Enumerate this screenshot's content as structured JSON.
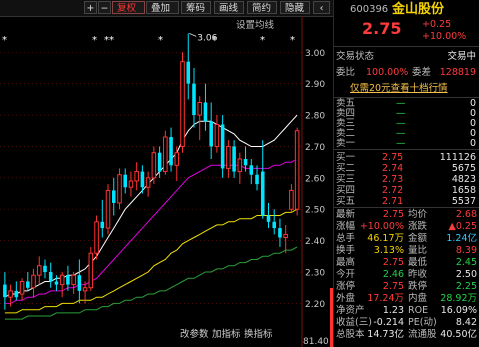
{
  "toolbar": {
    "items": [
      {
        "label": "+"
      },
      {
        "label": "−"
      },
      {
        "label": "复权"
      },
      {
        "label": "叠加"
      },
      {
        "label": "筹码"
      },
      {
        "label": "画线"
      },
      {
        "label": "简约"
      },
      {
        "label": "隐藏"
      },
      {
        "label": "‹"
      }
    ],
    "active_index": 2,
    "settings_label": "设置均线"
  },
  "markers": {
    "star": "*",
    "dstar": "**"
  },
  "bottom_buttons": [
    "改参数",
    "加指标",
    "换指标"
  ],
  "colors": {
    "up": "#ff3333",
    "down": "#00e5ff",
    "ma1": "#ffffff",
    "ma2": "#e000e0",
    "ma3": "#f0e000",
    "ma4": "#2a9f3a",
    "grid": "#7a1010"
  },
  "chart_data": {
    "type": "candlestick",
    "y_ticks": [
      "3.00",
      "2.90",
      "2.80",
      "2.70",
      "2.60",
      "2.50",
      "2.40",
      "2.30",
      "2.20"
    ],
    "ylim": [
      2.16,
      3.09
    ],
    "y_bottom_label": "81.40",
    "annotations": [
      {
        "text": "3.06",
        "value": 3.06
      }
    ],
    "ohlc": [
      [
        2.26,
        2.3,
        2.18,
        2.22
      ],
      [
        2.22,
        2.26,
        2.19,
        2.24
      ],
      [
        2.24,
        2.27,
        2.21,
        2.22
      ],
      [
        2.23,
        2.28,
        2.21,
        2.27
      ],
      [
        2.27,
        2.3,
        2.24,
        2.25
      ],
      [
        2.25,
        2.31,
        2.22,
        2.29
      ],
      [
        2.29,
        2.35,
        2.26,
        2.32
      ],
      [
        2.32,
        2.34,
        2.28,
        2.3
      ],
      [
        2.3,
        2.33,
        2.25,
        2.27
      ],
      [
        2.27,
        2.29,
        2.24,
        2.26
      ],
      [
        2.26,
        2.3,
        2.22,
        2.29
      ],
      [
        2.29,
        2.32,
        2.24,
        2.26
      ],
      [
        2.26,
        2.3,
        2.23,
        2.29
      ],
      [
        2.29,
        2.34,
        2.2,
        2.24
      ],
      [
        2.24,
        2.27,
        2.2,
        2.25
      ],
      [
        2.25,
        2.38,
        2.24,
        2.36
      ],
      [
        2.36,
        2.48,
        2.34,
        2.46
      ],
      [
        2.46,
        2.53,
        2.41,
        2.44
      ],
      [
        2.44,
        2.58,
        2.42,
        2.56
      ],
      [
        2.56,
        2.6,
        2.48,
        2.52
      ],
      [
        2.52,
        2.63,
        2.5,
        2.61
      ],
      [
        2.61,
        2.63,
        2.55,
        2.57
      ],
      [
        2.57,
        2.62,
        2.54,
        2.59
      ],
      [
        2.59,
        2.65,
        2.56,
        2.62
      ],
      [
        2.62,
        2.64,
        2.55,
        2.57
      ],
      [
        2.57,
        2.62,
        2.54,
        2.6
      ],
      [
        2.6,
        2.7,
        2.58,
        2.68
      ],
      [
        2.68,
        2.7,
        2.6,
        2.62
      ],
      [
        2.62,
        2.75,
        2.61,
        2.73
      ],
      [
        2.73,
        2.76,
        2.62,
        2.64
      ],
      [
        2.64,
        2.7,
        2.59,
        2.68
      ],
      [
        2.7,
        3.0,
        2.68,
        2.97
      ],
      [
        2.97,
        3.06,
        2.85,
        2.9
      ],
      [
        2.9,
        2.95,
        2.76,
        2.8
      ],
      [
        2.8,
        2.86,
        2.72,
        2.84
      ],
      [
        2.84,
        2.9,
        2.75,
        2.78
      ],
      [
        2.78,
        2.84,
        2.66,
        2.7
      ],
      [
        2.7,
        2.8,
        2.68,
        2.77
      ],
      [
        2.77,
        2.8,
        2.6,
        2.63
      ],
      [
        2.63,
        2.72,
        2.6,
        2.7
      ],
      [
        2.7,
        2.72,
        2.6,
        2.62
      ],
      [
        2.62,
        2.68,
        2.58,
        2.66
      ],
      [
        2.66,
        2.7,
        2.62,
        2.64
      ],
      [
        2.64,
        2.66,
        2.58,
        2.61
      ],
      [
        2.61,
        2.64,
        2.56,
        2.58
      ],
      [
        2.62,
        2.72,
        2.47,
        2.48
      ],
      [
        2.48,
        2.52,
        2.44,
        2.46
      ],
      [
        2.46,
        2.5,
        2.42,
        2.44
      ],
      [
        2.44,
        2.47,
        2.38,
        2.41
      ],
      [
        2.41,
        2.45,
        2.36,
        2.42
      ],
      [
        2.5,
        2.58,
        2.49,
        2.56
      ],
      [
        2.5,
        2.76,
        2.48,
        2.75
      ]
    ],
    "ma": [
      {
        "color": "#ffffff",
        "values": [
          2.22,
          2.23,
          2.23,
          2.24,
          2.24,
          2.25,
          2.26,
          2.27,
          2.27,
          2.28,
          2.28,
          2.29,
          2.29,
          2.3,
          2.31,
          2.33,
          2.35,
          2.38,
          2.41,
          2.44,
          2.47,
          2.5,
          2.52,
          2.54,
          2.56,
          2.58,
          2.6,
          2.62,
          2.64,
          2.66,
          2.68,
          2.72,
          2.75,
          2.77,
          2.78,
          2.78,
          2.78,
          2.77,
          2.76,
          2.75,
          2.74,
          2.72,
          2.71,
          2.7,
          2.7,
          2.7,
          2.71,
          2.72,
          2.74,
          2.76,
          2.78,
          2.8
        ]
      },
      {
        "color": "#e000e0",
        "values": [
          2.2,
          2.2,
          2.21,
          2.21,
          2.22,
          2.22,
          2.23,
          2.23,
          2.24,
          2.24,
          2.24,
          2.25,
          2.25,
          2.26,
          2.26,
          2.27,
          2.28,
          2.3,
          2.32,
          2.34,
          2.36,
          2.38,
          2.4,
          2.42,
          2.44,
          2.46,
          2.48,
          2.5,
          2.52,
          2.54,
          2.56,
          2.58,
          2.6,
          2.61,
          2.62,
          2.63,
          2.64,
          2.64,
          2.64,
          2.64,
          2.64,
          2.64,
          2.63,
          2.63,
          2.63,
          2.63,
          2.63,
          2.64,
          2.64,
          2.65,
          2.65,
          2.66
        ]
      },
      {
        "color": "#f0e000",
        "values": [
          2.17,
          2.17,
          2.17,
          2.18,
          2.18,
          2.18,
          2.18,
          2.19,
          2.19,
          2.19,
          2.2,
          2.2,
          2.2,
          2.21,
          2.21,
          2.21,
          2.22,
          2.22,
          2.23,
          2.24,
          2.25,
          2.26,
          2.27,
          2.28,
          2.29,
          2.3,
          2.32,
          2.33,
          2.34,
          2.36,
          2.37,
          2.39,
          2.4,
          2.41,
          2.42,
          2.43,
          2.44,
          2.45,
          2.45,
          2.46,
          2.46,
          2.47,
          2.47,
          2.47,
          2.48,
          2.48,
          2.48,
          2.48,
          2.48,
          2.49,
          2.49,
          2.5
        ]
      },
      {
        "color": "#2a9f3a",
        "values": [
          2.15,
          2.15,
          2.15,
          2.15,
          2.16,
          2.16,
          2.16,
          2.16,
          2.16,
          2.17,
          2.17,
          2.17,
          2.17,
          2.17,
          2.18,
          2.18,
          2.18,
          2.19,
          2.19,
          2.2,
          2.2,
          2.21,
          2.21,
          2.22,
          2.22,
          2.23,
          2.23,
          2.24,
          2.24,
          2.25,
          2.26,
          2.27,
          2.28,
          2.28,
          2.29,
          2.3,
          2.3,
          2.31,
          2.31,
          2.32,
          2.32,
          2.33,
          2.33,
          2.34,
          2.34,
          2.35,
          2.35,
          2.36,
          2.36,
          2.37,
          2.37,
          2.38
        ]
      }
    ]
  },
  "quote": {
    "code": "600396",
    "name": "金山股份",
    "price": "2.75",
    "change": "+0.25",
    "change_pct": "+10.00%",
    "status_label": "交易状态",
    "status_value": "交易中",
    "weibi_label": "委比",
    "weibi_value": "100.00%",
    "weicha_label": "委差",
    "weicha_value": "128819",
    "promo": "仅需20元查看十档行情",
    "sell": [
      {
        "label": "卖五",
        "price": "—",
        "vol": "0"
      },
      {
        "label": "卖四",
        "price": "—",
        "vol": "0"
      },
      {
        "label": "卖三",
        "price": "—",
        "vol": "0"
      },
      {
        "label": "卖二",
        "price": "—",
        "vol": "0"
      },
      {
        "label": "卖一",
        "price": "—",
        "vol": "0"
      }
    ],
    "buy": [
      {
        "label": "买一",
        "price": "2.75",
        "vol": "111126"
      },
      {
        "label": "买二",
        "price": "2.74",
        "vol": "5675"
      },
      {
        "label": "买三",
        "price": "2.73",
        "vol": "4823"
      },
      {
        "label": "买四",
        "price": "2.72",
        "vol": "1658"
      },
      {
        "label": "买五",
        "price": "2.71",
        "vol": "5537"
      }
    ],
    "stats": [
      {
        "l1": "最新",
        "v1": "2.75",
        "c1": "red",
        "l2": "均价",
        "v2": "2.68",
        "c2": "red"
      },
      {
        "l1": "涨幅",
        "v1": "+10.00%",
        "c1": "red",
        "l2": "涨跌",
        "v2": "▲0.25",
        "c2": "red"
      },
      {
        "l1": "总手",
        "v1": "46.17万",
        "c1": "yellow",
        "l2": "金额",
        "v2": "1.24亿",
        "c2": "cyan"
      },
      {
        "l1": "换手",
        "v1": "3.13%",
        "c1": "yellow",
        "l2": "量比",
        "v2": "8.39",
        "c2": "red"
      },
      {
        "l1": "最高",
        "v1": "2.75",
        "c1": "red",
        "l2": "最低",
        "v2": "2.45",
        "c2": "green"
      },
      {
        "l1": "今开",
        "v1": "2.46",
        "c1": "green",
        "l2": "昨收",
        "v2": "2.50",
        "c2": "white"
      },
      {
        "l1": "涨停",
        "v1": "2.75",
        "c1": "red",
        "l2": "跌停",
        "v2": "2.25",
        "c2": "green"
      },
      {
        "l1": "外盘",
        "v1": "17.24万",
        "c1": "red",
        "l2": "内盘",
        "v2": "28.92万",
        "c2": "green"
      },
      {
        "l1": "净资产",
        "v1": "1.23",
        "c1": "white",
        "l2": "ROE",
        "v2": "16.09%",
        "c2": "white"
      },
      {
        "l1": "收益(三)",
        "v1": "-0.214",
        "c1": "white",
        "l2": "PE(动)",
        "v2": "8.42",
        "c2": "white"
      },
      {
        "l1": "总股本",
        "v1": "14.73亿",
        "c1": "white",
        "l2": "流通股",
        "v2": "40.50亿",
        "c2": "white"
      }
    ]
  }
}
